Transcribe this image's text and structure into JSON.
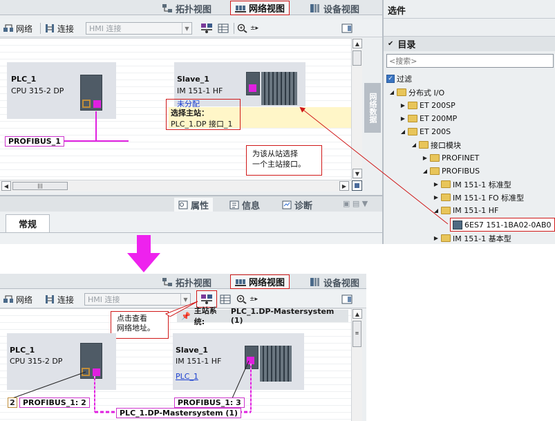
{
  "top_view_tabs": {
    "topology": "拓扑视图",
    "network": "网络视图",
    "device": "设备视图"
  },
  "toolbar": {
    "network": "网络",
    "connections": "连接",
    "hmi_combo_value": "HMI 连接"
  },
  "top_devices": {
    "plc": {
      "name": "PLC_1",
      "type": "CPU 315-2 DP"
    },
    "slave": {
      "name": "Slave_1",
      "type": "IM 151-1 HF",
      "status": "未分配"
    }
  },
  "top_network": {
    "subnet_label": "PROFIBUS_1"
  },
  "master_select": {
    "title": "选择主站：",
    "option": "PLC_1.DP 接口_1"
  },
  "callout_top": {
    "line1": "为该从站选择",
    "line2": "一个主站接口。"
  },
  "side_tab": {
    "label": "网络数据"
  },
  "inspector": {
    "properties": "属性",
    "info": "信息",
    "diagnostics": "诊断",
    "general_tab": "常规"
  },
  "catalog": {
    "title": "选件",
    "section": "目录",
    "search_placeholder": "<搜索>",
    "filter": "过滤",
    "tree": [
      {
        "label": "分布式 I/O"
      },
      {
        "label": "ET 200SP"
      },
      {
        "label": "ET 200MP"
      },
      {
        "label": "ET 200S"
      },
      {
        "label": "接口模块"
      },
      {
        "label": "PROFINET"
      },
      {
        "label": "PROFIBUS"
      },
      {
        "label": "IM 151-1 标准型"
      },
      {
        "label": "IM 151-1 FO 标准型"
      },
      {
        "label": "IM 151-1 HF"
      },
      {
        "label": "6ES7 151-1BA02-0AB0"
      },
      {
        "label": "IM 151-1 基本型"
      }
    ]
  },
  "bottom": {
    "master_system_label": "主站系统:",
    "master_system_value": "PLC_1.DP-Mastersystem (1)",
    "callout": {
      "line1": "点击查看",
      "line2": "网络地址。"
    },
    "plc": {
      "name": "PLC_1",
      "type": "CPU 315-2 DP",
      "address": "2",
      "subnet": "PROFIBUS_1: 2"
    },
    "slave": {
      "name": "Slave_1",
      "type": "IM 151-1 HF",
      "master_link": "PLC_1",
      "subnet": "PROFIBUS_1: 3"
    },
    "mastersystem_line": "PLC_1.DP-Mastersystem (1)"
  },
  "colors": {
    "highlight_red": "#d01818",
    "profibus_magenta": "#e020e0",
    "arrow_magenta": "#ee22ee",
    "station_yellow": "#fff6c8"
  }
}
